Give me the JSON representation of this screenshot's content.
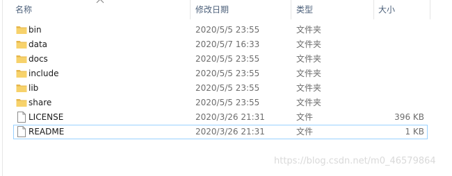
{
  "columns": {
    "name": "名称",
    "modified": "修改日期",
    "type": "类型",
    "size": "大小"
  },
  "rows": [
    {
      "name": "bin",
      "modified": "2020/5/5 23:55",
      "type": "文件夹",
      "size": "",
      "icon": "folder-icon"
    },
    {
      "name": "data",
      "modified": "2020/5/7 16:33",
      "type": "文件夹",
      "size": "",
      "icon": "folder-icon"
    },
    {
      "name": "docs",
      "modified": "2020/5/5 23:55",
      "type": "文件夹",
      "size": "",
      "icon": "folder-icon"
    },
    {
      "name": "include",
      "modified": "2020/5/5 23:55",
      "type": "文件夹",
      "size": "",
      "icon": "folder-icon"
    },
    {
      "name": "lib",
      "modified": "2020/5/5 23:55",
      "type": "文件夹",
      "size": "",
      "icon": "folder-icon"
    },
    {
      "name": "share",
      "modified": "2020/5/5 23:55",
      "type": "文件夹",
      "size": "",
      "icon": "folder-icon"
    },
    {
      "name": "LICENSE",
      "modified": "2020/3/26 21:31",
      "type": "文件",
      "size": "396 KB",
      "icon": "file-icon"
    },
    {
      "name": "README",
      "modified": "2020/3/26 21:31",
      "type": "文件",
      "size": "1 KB",
      "icon": "file-icon"
    }
  ],
  "watermark": "https://blog.csdn.net/m0_46579864",
  "colors": {
    "folder": "#f7d26b",
    "folder_dark": "#e6b54a",
    "focus_border": "#99d1ff",
    "header_text": "#4c607a"
  }
}
